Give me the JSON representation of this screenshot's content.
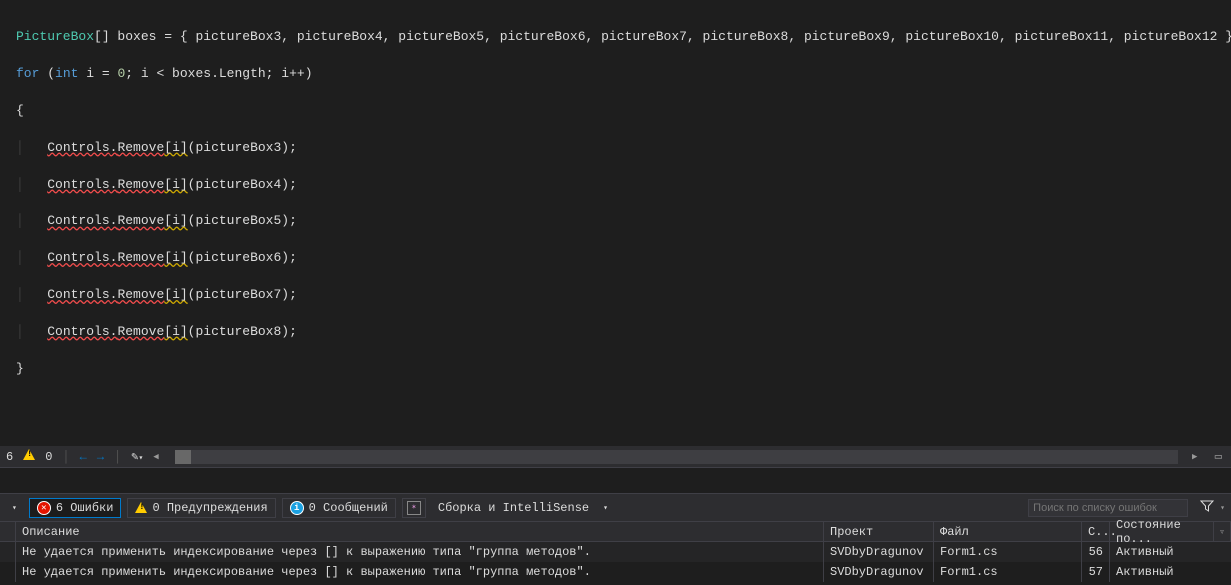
{
  "code": {
    "line1": {
      "type": "PictureBox",
      "brackets": "[] ",
      "var": "boxes",
      "eq": " = { ",
      "items": "pictureBox3, pictureBox4, pictureBox5, pictureBox6, pictureBox7, pictureBox8, pictureBox9, pictureBox10, pictureBox11, pictureBox12 };"
    },
    "line2": {
      "for": "for",
      "p1": " (",
      "int": "int",
      "v": " i = ",
      "zero": "0",
      "semi": "; i < boxes.Length; i",
      "inc": "++",
      "end": ")"
    },
    "brace_open": "{",
    "remove_lines": [
      {
        "ctrl": "Controls",
        "dot": ".",
        "rem": "Remove",
        "idx": "[i]",
        "arg": "(pictureBox3);"
      },
      {
        "ctrl": "Controls",
        "dot": ".",
        "rem": "Remove",
        "idx": "[i]",
        "arg": "(pictureBox4);"
      },
      {
        "ctrl": "Controls",
        "dot": ".",
        "rem": "Remove",
        "idx": "[i]",
        "arg": "(pictureBox5);"
      },
      {
        "ctrl": "Controls",
        "dot": ".",
        "rem": "Remove",
        "idx": "[i]",
        "arg": "(pictureBox6);"
      },
      {
        "ctrl": "Controls",
        "dot": ".",
        "rem": "Remove",
        "idx": "[i]",
        "arg": "(pictureBox7);"
      },
      {
        "ctrl": "Controls",
        "dot": ".",
        "rem": "Remove",
        "idx": "[i]",
        "arg": "(pictureBox8);"
      }
    ],
    "brace_close": "}"
  },
  "navbar": {
    "issues": "6",
    "warnings": "0"
  },
  "toolbar": {
    "errors_count": "6 Ошибки",
    "warnings_count": "0 Предупреждения",
    "messages_count": "0 Сообщений",
    "build_label": "Сборка и IntelliSense",
    "search_placeholder": "Поиск по списку ошибок"
  },
  "headers": {
    "desc": "Описание",
    "proj": "Проект",
    "file": "Файл",
    "line": "С...",
    "state": "Состояние по..."
  },
  "errors": [
    {
      "desc": "Не удается применить индексирование через [] к выражению типа \"группа методов\".",
      "proj": "SVDbyDragunov",
      "file": "Form1.cs",
      "line": "56",
      "state": "Активный"
    },
    {
      "desc": "Не удается применить индексирование через [] к выражению типа \"группа методов\".",
      "proj": "SVDbyDragunov",
      "file": "Form1.cs",
      "line": "57",
      "state": "Активный"
    }
  ]
}
